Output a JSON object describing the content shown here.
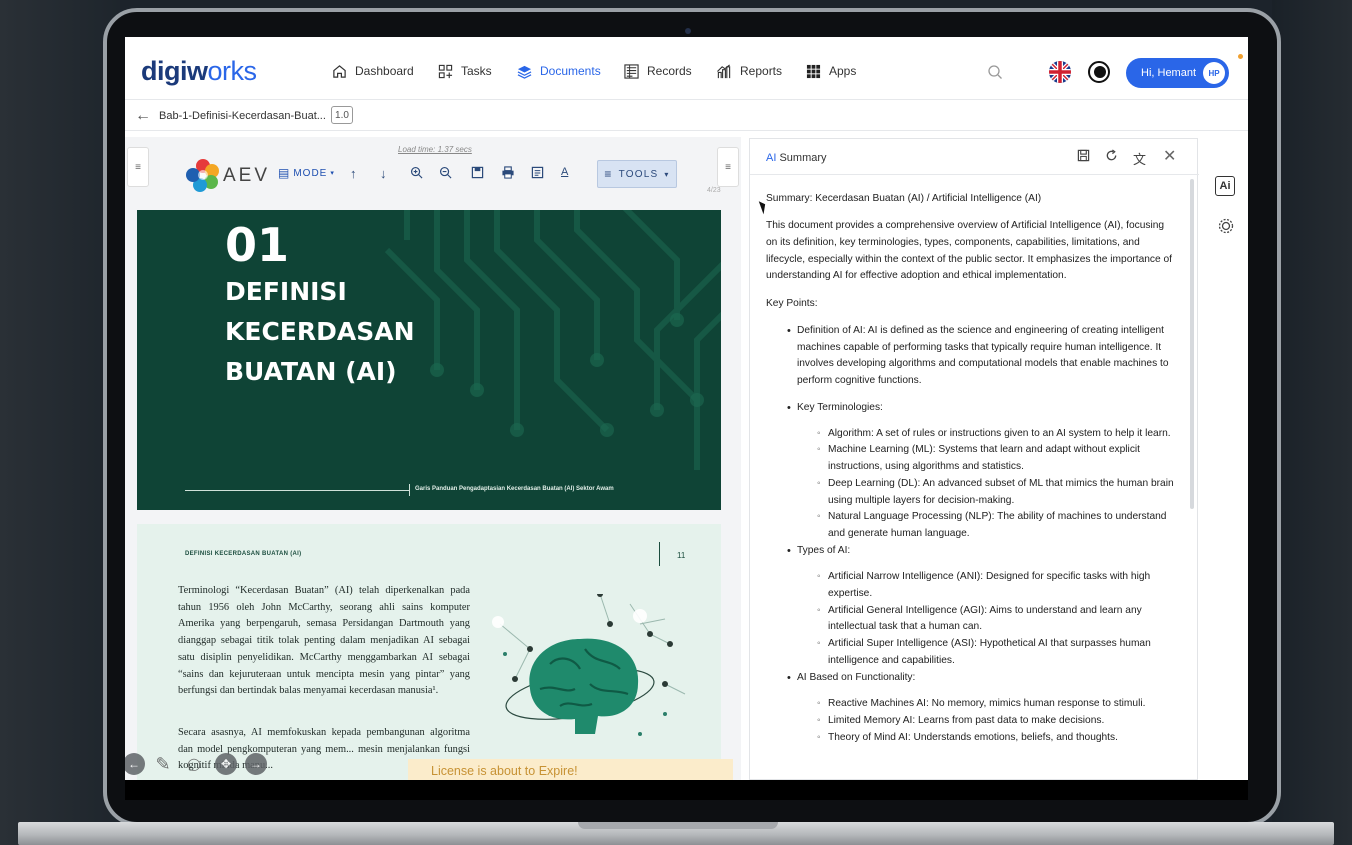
{
  "brand": {
    "name_main": "digiw",
    "name_accent": "rks",
    "logo_glyph": "o"
  },
  "nav": [
    {
      "label": "Dashboard",
      "icon": "home-icon"
    },
    {
      "label": "Tasks",
      "icon": "tasks-icon"
    },
    {
      "label": "Documents",
      "icon": "documents-icon",
      "active": true
    },
    {
      "label": "Records",
      "icon": "records-icon"
    },
    {
      "label": "Reports",
      "icon": "reports-icon"
    },
    {
      "label": "Apps",
      "icon": "apps-icon"
    }
  ],
  "user": {
    "greeting": "Hi, Hemant",
    "initials": "HP"
  },
  "breadcrumb": {
    "title": "Bab-1-Definisi-Kecerdasan-Buat...",
    "version": "1.0"
  },
  "viewer": {
    "load_time": "Load time: 1.37 secs",
    "brand": "AEV",
    "mode_label": "MODE",
    "tools_label": "TOOLS",
    "page_indicator": "4/23",
    "cover": {
      "number": "01",
      "title_lines": [
        "DEFINISI",
        "KECERDASAN",
        "BUATAN (AI)"
      ],
      "guide_text": "Garis Panduan Pengadaptasian Kecerdasan Buatan (AI) Sektor Awam"
    },
    "inner": {
      "heading": "DEFINISI KECERDASAN BUATAN (AI)",
      "page_number": "11",
      "para1": "Terminologi “Kecerdasan Buatan” (AI) telah diperkenalkan pada tahun 1956 oleh John McCarthy, seorang ahli sains komputer Amerika yang berpengaruh, semasa Persidangan Dartmouth yang dianggap sebagai titik tolak penting dalam menjadikan AI sebagai satu disiplin penyelidikan. McCarthy menggambarkan AI sebagai “sains dan kejuruteraan untuk mencipta mesin yang pintar” yang berfungsi dan bertindak balas menyamai kecerdasan manusia¹.",
      "para2": "Secara asasnya, AI memfokuskan kepada pembangunan algoritma dan model pengkomputeran yang mem... mesin menjalankan fungsi kognitif minda manu..."
    },
    "license_warning": "License is about to Expire!"
  },
  "summary": {
    "title_ai": "AI",
    "title_rest": " Summary",
    "heading": "Summary: Kecerdasan Buatan (AI) / Artificial Intelligence (AI)",
    "intro": "This document provides a comprehensive overview of Artificial Intelligence (AI), focusing on its definition, key terminologies, types, components, capabilities, limitations, and lifecycle, especially within the context of the public sector. It emphasizes the importance of understanding AI for effective adoption and ethical implementation.",
    "key_points_label": "Key Points:",
    "points": [
      {
        "text": "Definition of AI: AI is defined as the science and engineering of creating intelligent machines capable of performing tasks that typically require human intelligence. It involves developing algorithms and computational models that enable machines to perform cognitive functions.",
        "sub": []
      },
      {
        "text": "Key Terminologies:",
        "sub": [
          "Algorithm: A set of rules or instructions given to an AI system to help it learn.",
          "Machine Learning (ML): Systems that learn and adapt without explicit instructions, using algorithms and statistics.",
          "Deep Learning (DL): An advanced subset of ML that mimics the human brain using multiple layers for decision-making.",
          "Natural Language Processing (NLP): The ability of machines to understand and generate human language."
        ]
      },
      {
        "text": "Types of AI:",
        "sub": [
          "Artificial Narrow Intelligence (ANI): Designed for specific tasks with high expertise.",
          "Artificial General Intelligence (AGI): Aims to understand and learn any intellectual task that a human can.",
          "Artificial Super Intelligence (ASI): Hypothetical AI that surpasses human intelligence and capabilities."
        ]
      },
      {
        "text": "AI Based on Functionality:",
        "sub": [
          "Reactive Machines AI: No memory, mimics human response to stimuli.",
          "Limited Memory AI: Learns from past data to make decisions.",
          "Theory of Mind AI: Understands emotions, beliefs, and thoughts."
        ]
      }
    ]
  },
  "rail": {
    "ai_label": "Ai"
  }
}
